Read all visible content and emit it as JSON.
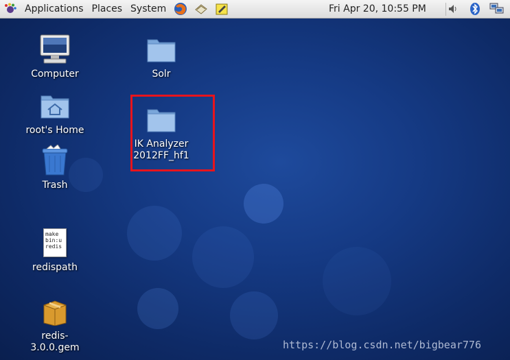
{
  "panel": {
    "menus": [
      "Applications",
      "Places",
      "System"
    ],
    "clock": "Fri Apr 20, 10:55 PM"
  },
  "desktop": {
    "icons": [
      {
        "label": "Computer",
        "icon": "computer-icon"
      },
      {
        "label": "Solr",
        "icon": "folder-icon"
      },
      {
        "label": "root's Home",
        "icon": "home-folder-icon"
      },
      {
        "label": "IK Analyzer\n2012FF_hf1",
        "icon": "folder-icon"
      },
      {
        "label": "Trash",
        "icon": "trash-icon"
      },
      {
        "label": "redispath",
        "icon": "text-file-icon",
        "preview": "make\nbin:u\nredis"
      },
      {
        "label": "redis-3.0.0.gem",
        "icon": "package-icon"
      }
    ]
  },
  "watermark": "https://blog.csdn.net/bigbear776",
  "colors": {
    "highlight": "#e8141c",
    "desktop_bg": "#153a84",
    "folder": "#8fb7e6"
  }
}
